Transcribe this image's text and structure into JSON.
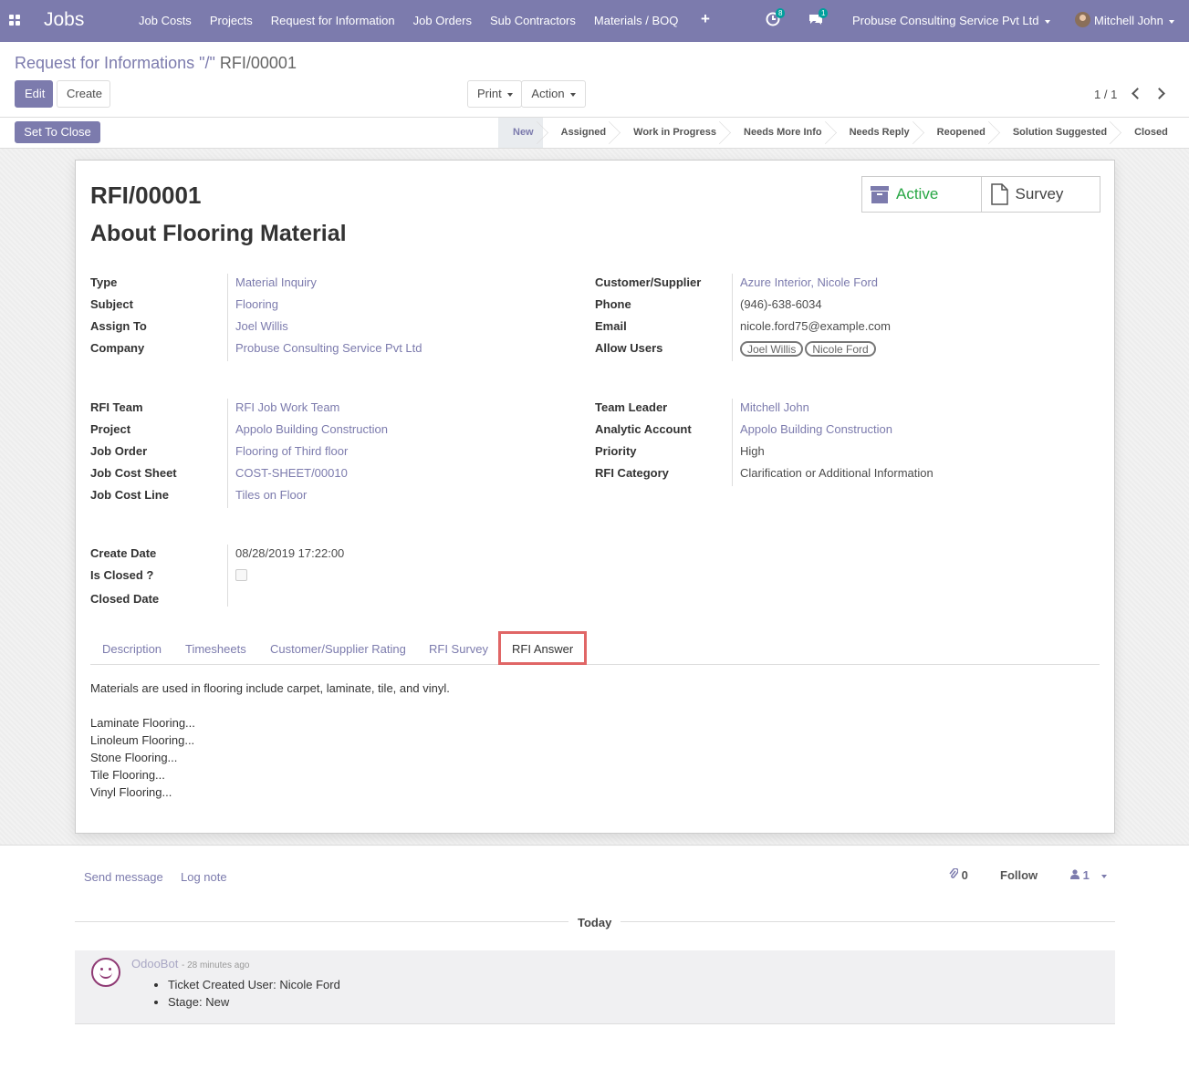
{
  "navbar": {
    "brand": "Jobs",
    "menu": [
      "Job Costs",
      "Projects",
      "Request for Information",
      "Job Orders",
      "Sub Contractors",
      "Materials / BOQ"
    ],
    "plus": "+",
    "activity_count": "8",
    "messages_count": "1",
    "company": "Probuse Consulting Service Pvt Ltd",
    "user": "Mitchell John"
  },
  "control": {
    "breadcrumb_parent": "Request for Informations \"/\"",
    "breadcrumb_current": "RFI/00001",
    "edit": "Edit",
    "create": "Create",
    "print": "Print",
    "action": "Action",
    "pager": "1 / 1"
  },
  "statusbar": {
    "set_close": "Set To Close",
    "stages": [
      "New",
      "Assigned",
      "Work in Progress",
      "Needs More Info",
      "Needs Reply",
      "Reopened",
      "Solution Suggested",
      "Closed"
    ],
    "active_stage": "New"
  },
  "record": {
    "number": "RFI/00001",
    "title": "About Flooring Material",
    "smart_buttons": {
      "active": "Active",
      "survey": "Survey"
    },
    "left1": [
      {
        "label": "Type",
        "value": "Material Inquiry",
        "link": true
      },
      {
        "label": "Subject",
        "value": "Flooring",
        "link": true
      },
      {
        "label": "Assign To",
        "value": "Joel Willis",
        "link": true
      },
      {
        "label": "Company",
        "value": "Probuse Consulting Service Pvt Ltd",
        "link": true
      }
    ],
    "right1": [
      {
        "label": "Customer/Supplier",
        "value": "Azure Interior, Nicole Ford",
        "link": true
      },
      {
        "label": "Phone",
        "value": "(946)-638-6034",
        "link": false
      },
      {
        "label": "Email",
        "value": "nicole.ford75@example.com",
        "link": false
      },
      {
        "label": "Allow Users",
        "tags": [
          "Joel Willis",
          "Nicole Ford"
        ]
      }
    ],
    "left2": [
      {
        "label": "RFI Team",
        "value": "RFI Job Work Team",
        "link": true
      },
      {
        "label": "Project",
        "value": "Appolo Building Construction",
        "link": true
      },
      {
        "label": "Job Order",
        "value": "Flooring of Third floor",
        "link": true
      },
      {
        "label": "Job Cost Sheet",
        "value": "COST-SHEET/00010",
        "link": true
      },
      {
        "label": "Job Cost Line",
        "value": "Tiles on Floor",
        "link": true
      }
    ],
    "right2": [
      {
        "label": "Team Leader",
        "value": "Mitchell John",
        "link": true
      },
      {
        "label": "Analytic Account",
        "value": "Appolo Building Construction",
        "link": true
      },
      {
        "label": "Priority",
        "value": "High",
        "link": false
      },
      {
        "label": "RFI Category",
        "value": "Clarification or Additional Information",
        "link": false
      }
    ],
    "left3": [
      {
        "label": "Create Date",
        "value": "08/28/2019 17:22:00",
        "link": false
      },
      {
        "label": "Is Closed ?",
        "checkbox": true
      },
      {
        "label": "Closed Date",
        "value": "",
        "link": false
      }
    ],
    "tabs": [
      "Description",
      "Timesheets",
      "Customer/Supplier Rating",
      "RFI Survey",
      "RFI Answer"
    ],
    "active_tab": "RFI Answer",
    "answer_intro": "Materials are used in flooring include carpet, laminate, tile, and vinyl.",
    "answer_lines": [
      "Laminate Flooring...",
      "Linoleum Flooring...",
      "Stone Flooring...",
      "Tile Flooring...",
      "Vinyl Flooring..."
    ]
  },
  "chatter": {
    "send_message": "Send message",
    "log_note": "Log note",
    "attachments": "0",
    "follow": "Follow",
    "followers": "1",
    "today": "Today",
    "author": "OdooBot",
    "time": "28 minutes ago",
    "items": [
      "Ticket Created User: Nicole Ford",
      "Stage: New"
    ]
  },
  "colors": {
    "primary": "#7c7bad",
    "active_green": "#28a745",
    "highlight": "#e06666"
  }
}
